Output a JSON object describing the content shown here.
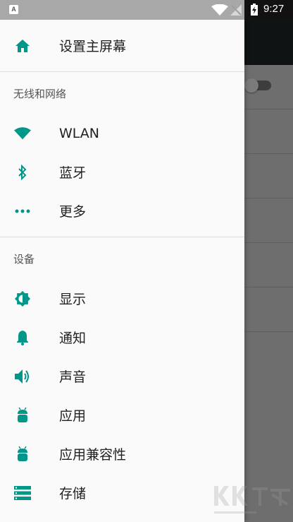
{
  "status_bar": {
    "app_icon_letter": "A",
    "time": "9:27"
  },
  "drawer": {
    "home": {
      "label": "设置主屏幕",
      "icon": "home-icon"
    },
    "sections": [
      {
        "header": "无线和网络",
        "items": [
          {
            "label": "WLAN",
            "icon": "wifi-icon"
          },
          {
            "label": "蓝牙",
            "icon": "bluetooth-icon"
          },
          {
            "label": "更多",
            "icon": "more-horiz-icon"
          }
        ]
      },
      {
        "header": "设备",
        "items": [
          {
            "label": "显示",
            "icon": "brightness-icon"
          },
          {
            "label": "通知",
            "icon": "bell-icon"
          },
          {
            "label": "声音",
            "icon": "volume-icon"
          },
          {
            "label": "应用",
            "icon": "android-icon"
          },
          {
            "label": "应用兼容性",
            "icon": "android-icon"
          },
          {
            "label": "存储",
            "icon": "storage-icon"
          }
        ]
      }
    ]
  },
  "colors": {
    "accent": "#009688",
    "drawer_bg": "#fafafa",
    "text_primary": "#212121",
    "text_secondary": "#555555",
    "scrim": "#6e6e6e"
  }
}
